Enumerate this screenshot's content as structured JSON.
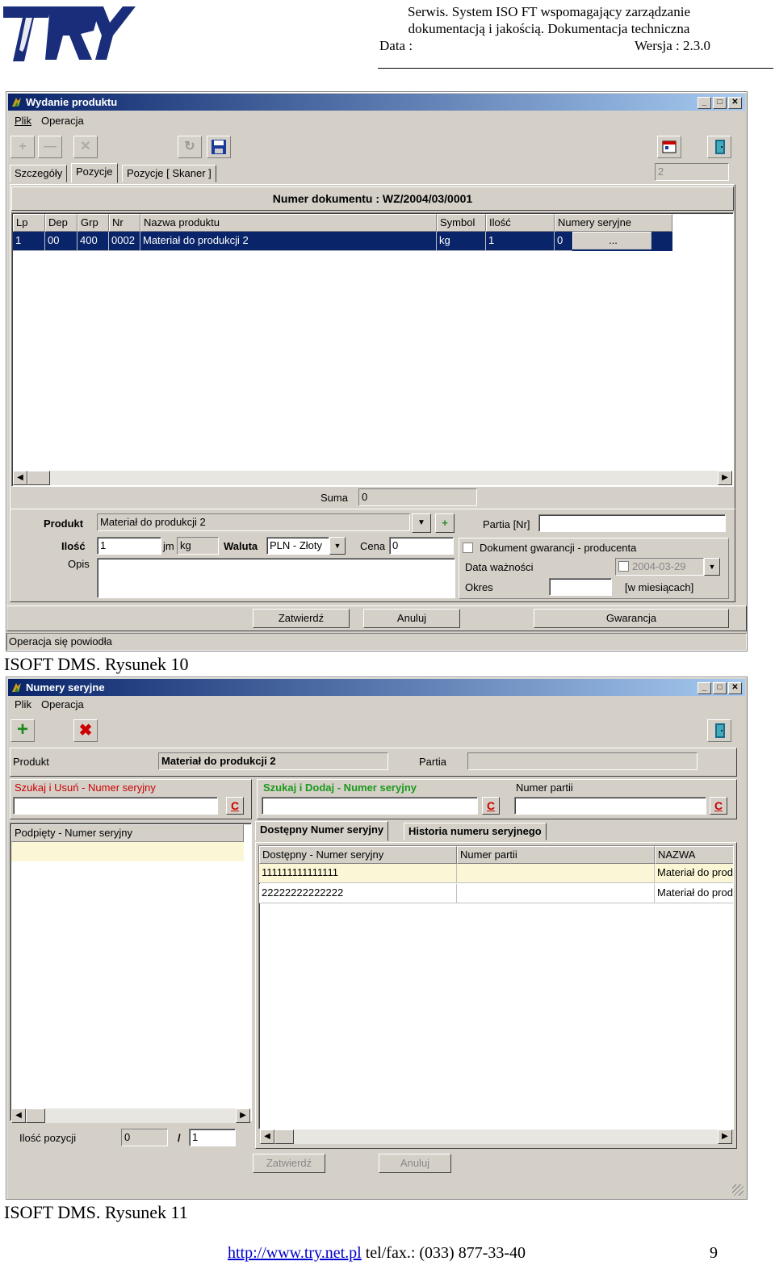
{
  "header": {
    "line1": "Serwis. System ISO FT wspomagający zarządzanie",
    "line2": "dokumentacją i jakością. Dokumentacja techniczna",
    "date_label": "Data :",
    "version": "Wersja : 2.3.0"
  },
  "window1": {
    "title": "Wydanie produktu",
    "menu": [
      "Plik",
      "Operacja"
    ],
    "tabs": [
      "Szczegóły",
      "Pozycje",
      "Pozycje [ Skaner ]"
    ],
    "counter_value": "2",
    "doc_number": "Numer dokumentu : WZ/2004/03/0001",
    "columns": [
      "Lp",
      "Dep",
      "Grp",
      "Nr",
      "Nazwa produktu",
      "Symbol",
      "Ilość",
      "Numery seryjne"
    ],
    "rows": [
      {
        "lp": "1",
        "dep": "00",
        "grp": "400",
        "nr": "0002",
        "nazwa": "Materiał do produkcji 2",
        "symbol": "kg",
        "ilosc": "1",
        "numery": "0",
        "button": "..."
      }
    ],
    "suma_label": "Suma",
    "suma_value": "0",
    "produkt_label": "Produkt",
    "produkt_value": "Materiał do produkcji 2",
    "plus_label": "+",
    "partia_label": "Partia [Nr]",
    "ilosc_label": "Ilość",
    "ilosc_value": "1",
    "jm_label": "jm",
    "jm_value": "kg",
    "waluta_label": "Waluta",
    "waluta_value": "PLN - Złoty",
    "cena_label": "Cena",
    "cena_value": "0",
    "opis_label": "Opis",
    "gwarancja_checkbox": "Dokument gwarancji - producenta",
    "data_waznosci_label": "Data ważności",
    "data_waznosci_value": "2004-03-29",
    "okres_label": "Okres",
    "okres_unit": "[w miesiącach]",
    "btn_zatwierdz": "Zatwierdź",
    "btn_anuluj": "Anuluj",
    "btn_gwarancja": "Gwarancja",
    "status": "Operacja się powiodła"
  },
  "caption1": "ISOFT DMS. Rysunek 10",
  "window2": {
    "title": "Numery seryjne",
    "menu": [
      "Plik",
      "Operacja"
    ],
    "produkt_label": "Produkt",
    "produkt_value": "Materiał do produkcji 2",
    "partia_label": "Partia",
    "search_delete_label": "Szukaj i Usuń - Numer seryjny",
    "search_add_label": "Szukaj i Dodaj - Numer seryjny",
    "numer_partii_label": "Numer partii",
    "c_label": "C",
    "left_column": "Podpięty - Numer seryjny",
    "tabs": [
      "Dostępny Numer seryjny",
      "Historia numeru seryjnego"
    ],
    "columns": [
      "Dostępny - Numer seryjny",
      "Numer partii",
      "NAZWA"
    ],
    "rows": [
      {
        "numer": "111111111111111",
        "partia": "",
        "nazwa": "Materiał do prod"
      },
      {
        "numer": "22222222222222",
        "partia": "",
        "nazwa": "Materiał do prod"
      }
    ],
    "ilosc_pozycji_label": "Ilość pozycji",
    "ilosc_pozycji_value": "0",
    "slash": "/",
    "total_value": "1",
    "btn_zatwierdz": "Zatwierdź",
    "btn_anuluj": "Anuluj"
  },
  "caption2": "ISOFT DMS. Rysunek 11",
  "footer": {
    "url": "http://www.try.net.pl",
    "phone": "tel/fax.: (033) 877-33-40",
    "page": "9"
  }
}
